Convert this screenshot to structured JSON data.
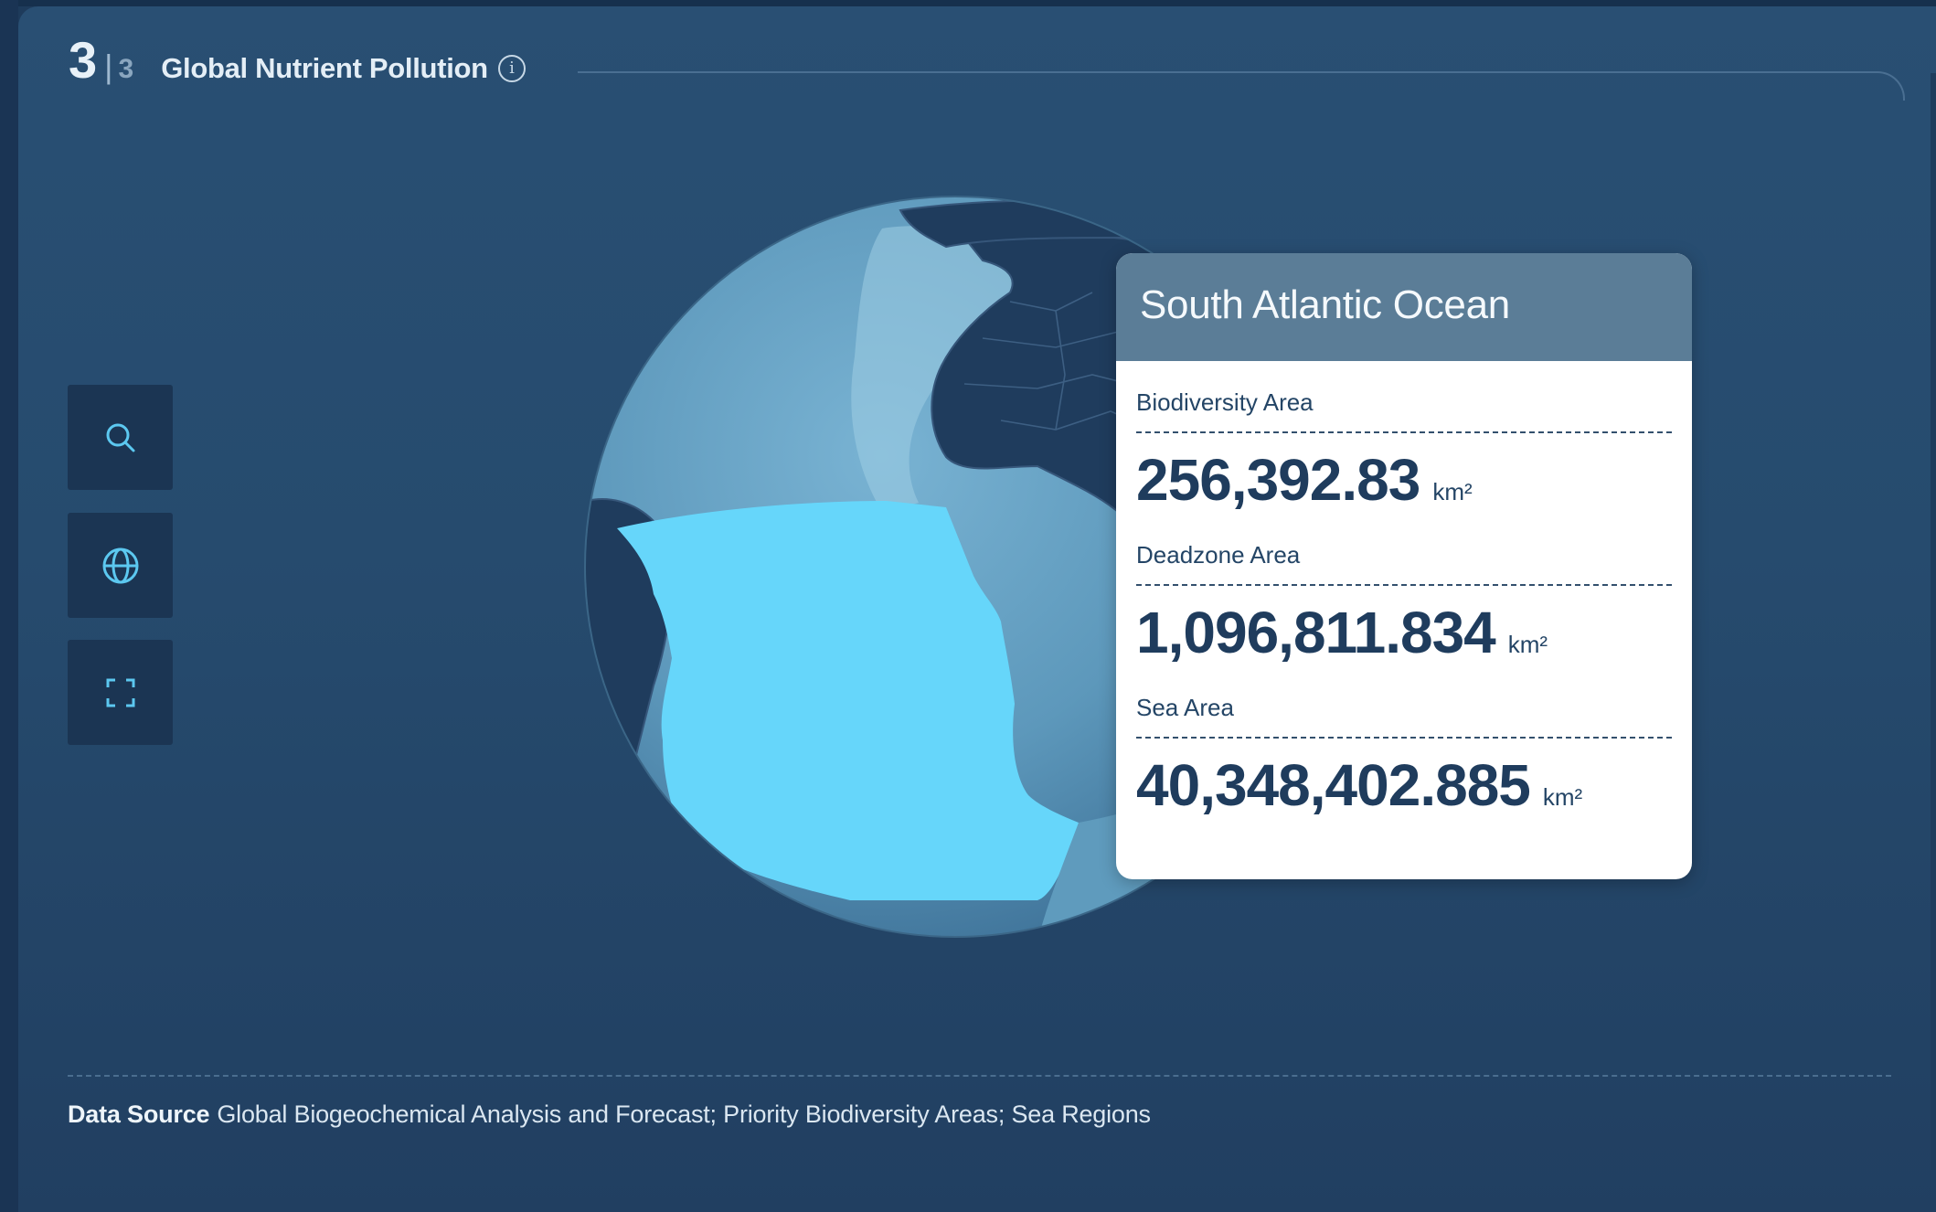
{
  "header": {
    "step_current": "3",
    "step_separator": "|",
    "step_total": "3",
    "title": "Global Nutrient Pollution",
    "info_icon": "info-icon"
  },
  "toolbar": {
    "buttons": [
      {
        "icon": "search-icon"
      },
      {
        "icon": "globe-icon"
      },
      {
        "icon": "fullscreen-icon"
      }
    ]
  },
  "colors": {
    "background": "#1e3b5b",
    "panel": "#264b6e",
    "accent_region": "#66d6fa",
    "card_header": "#5b7d97",
    "land": "#1f3c5d",
    "ocean": "#5f9bbd"
  },
  "tooltip": {
    "region_name": "South Atlantic Ocean",
    "metrics": [
      {
        "label": "Biodiversity Area",
        "value": "256,392.83",
        "unit": "km²"
      },
      {
        "label": "Deadzone Area",
        "value": "1,096,811.834",
        "unit": "km²"
      },
      {
        "label": "Sea Area",
        "value": "40,348,402.885",
        "unit": "km²"
      }
    ]
  },
  "footer": {
    "label": "Data Source",
    "text": "Global Biogeochemical Analysis and Forecast; Priority Biodiversity Areas; Sea Regions"
  }
}
